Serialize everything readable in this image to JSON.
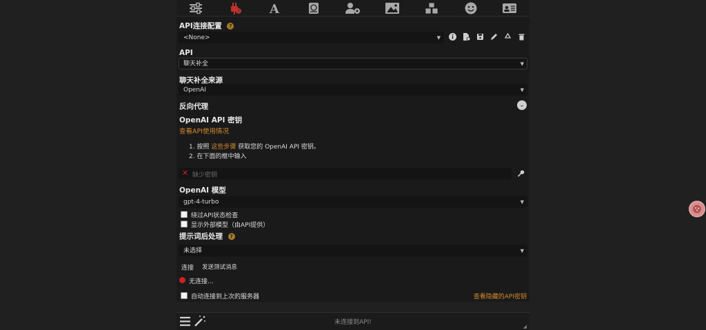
{
  "topbar": {
    "icons": [
      "sliders-icon",
      "plug-icon",
      "font-icon",
      "book-icon",
      "user-gear-icon",
      "image-icon",
      "cubes-icon",
      "smile-icon",
      "id-card-icon"
    ],
    "active_color": "#c0322d"
  },
  "api_config": {
    "title": "API连接配置",
    "help": "?",
    "profile_value": "<None>"
  },
  "api": {
    "label": "API",
    "value": "聊天补全"
  },
  "source": {
    "label": "聊天补全来源",
    "value": "OpenAI"
  },
  "proxy": {
    "label": "反向代理"
  },
  "openai_key": {
    "label": "OpenAI API 密钥",
    "usage_link": "查看API使用情况",
    "step1_prefix": "1. 按照",
    "step1_link": "这些步骤",
    "step1_suffix": "获取您的 OpenAI API 密钥。",
    "step2": "2. 在下面的框中输入",
    "placeholder": "缺少密钥"
  },
  "model": {
    "label": "OpenAI 模型",
    "value": "gpt-4-turbo",
    "skip_check": "绕过API状态检查",
    "show_external": "显示外部模型（由API提供）"
  },
  "postprocess": {
    "label": "提示词后处理",
    "help": "?",
    "value": "未选择"
  },
  "actions": {
    "connect": "连接",
    "test_message": "发送测试消息"
  },
  "status": {
    "text": "无连接...",
    "color": "#d11f1f"
  },
  "auto_connect": {
    "label": "自动连接到上次的服务器",
    "hidden_keys_link": "查看隐藏的API密钥"
  },
  "bottom": {
    "placeholder": "未连接到API!"
  },
  "colors": {
    "accent": "#d38a2e",
    "background": "#202020",
    "panel": "#1a1a1a"
  }
}
